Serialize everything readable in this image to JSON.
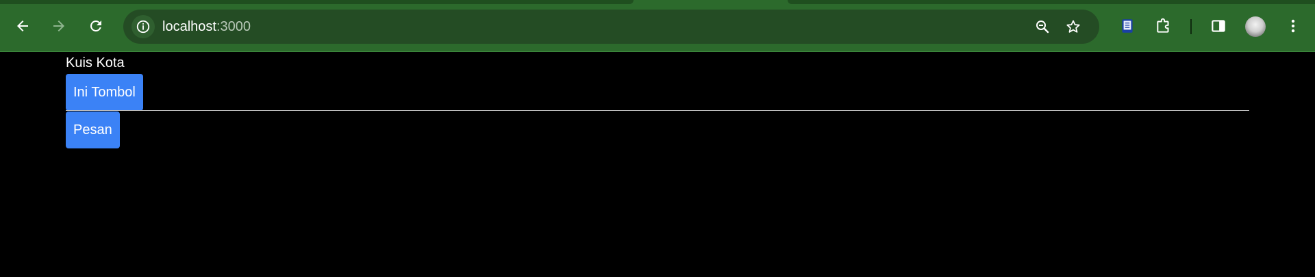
{
  "browser": {
    "url_host": "localhost",
    "url_port": ":3000",
    "icons": {
      "back": "arrow-left-icon",
      "forward": "arrow-right-icon",
      "reload": "reload-icon",
      "site_info": "info-icon",
      "zoom": "zoom-out-icon",
      "bookmark": "star-icon",
      "extension_reader": "book-icon",
      "extensions": "puzzle-icon",
      "side_panel": "side-panel-icon",
      "menu": "kebab-menu-icon"
    },
    "colors": {
      "toolbar": "#2c6a2c",
      "omnibox": "#244c24"
    }
  },
  "page": {
    "title": "Kuis Kota",
    "primary_button_label": "Ini Tombol",
    "secondary_button_label": "Pesan",
    "button_color": "#3b82f6",
    "background": "#000000"
  }
}
